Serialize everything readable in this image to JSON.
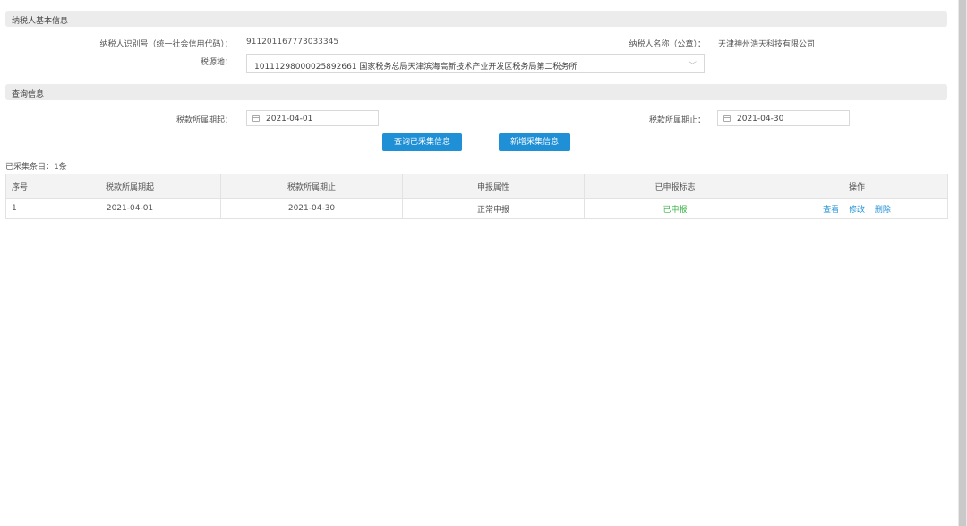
{
  "basic": {
    "section_title": "纳税人基本信息",
    "tax_id_label": "纳税人识别号（统一社会信用代码）：",
    "tax_id_value": "91120116773303334 5",
    "name_label": "纳税人名称（公章）：",
    "name_value": "天津神州浩天科技有限公司",
    "source_label": "税源地：",
    "source_value": "10111298000025892661 国家税务总局天津滨海高新技术产业开发区税务局第二税务所"
  },
  "query": {
    "section_title": "查询信息",
    "start_label": "税款所属期起：",
    "start_value": "2021-04-01",
    "end_label": "税款所属期止：",
    "end_value": "2021-04-30",
    "query_button": "查询已采集信息",
    "add_button": "新增采集信息"
  },
  "list": {
    "count_text": "已采集条目：1条",
    "headers": [
      "序号",
      "税款所属期起",
      "税款所属期止",
      "申报属性",
      "已申报标志",
      "操作"
    ],
    "rows": [
      {
        "index": "1",
        "start": "2021-04-01",
        "end": "2021-04-30",
        "attr": "正常申报",
        "flag": "已申报",
        "actions": [
          "查看",
          "修改",
          "删除"
        ]
      }
    ]
  },
  "colors": {
    "accent": "#1f8fd6",
    "success": "#3bb34a"
  },
  "icons": {
    "calendar": "calendar-icon",
    "dropdown": "chevron-down-icon"
  }
}
